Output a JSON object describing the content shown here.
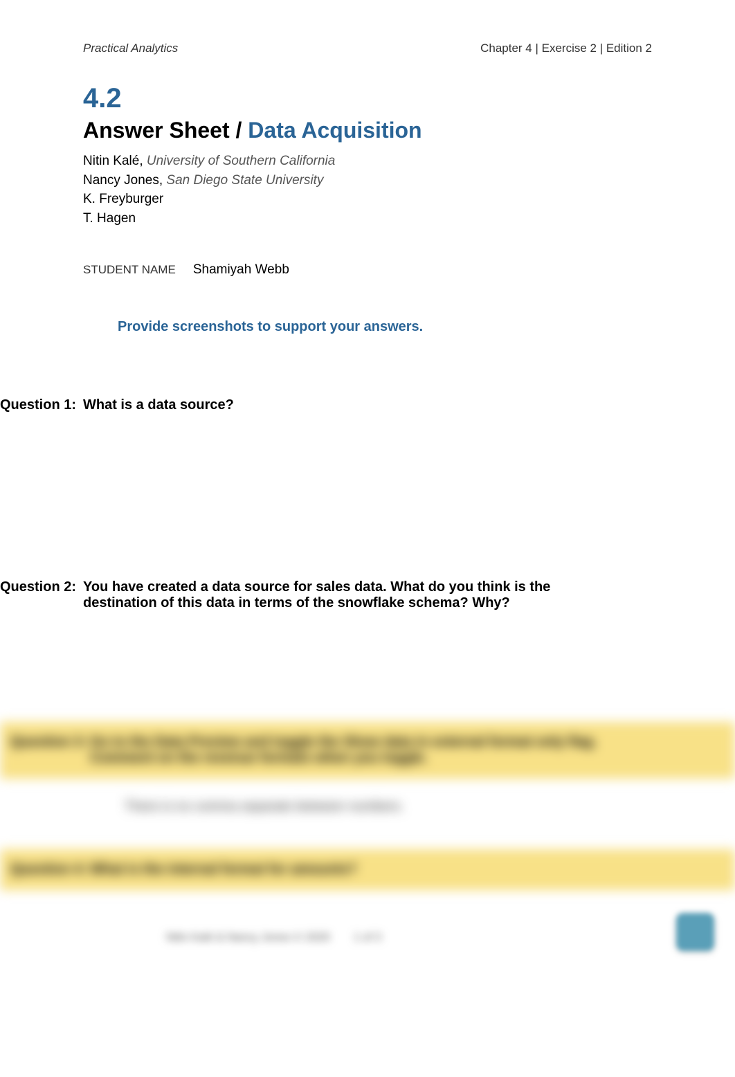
{
  "header": {
    "left": "Practical Analytics",
    "right": "Chapter 4 | Exercise 2 | Edition 2"
  },
  "section_number": "4.2",
  "title": {
    "prefix": "Answer Sheet / ",
    "topic": "Data Acquisition"
  },
  "authors": [
    {
      "name": "Nitin Kalé,",
      "affiliation": "University of Southern California"
    },
    {
      "name": "Nancy Jones,",
      "affiliation": "San Diego State University"
    },
    {
      "name": "K. Freyburger",
      "affiliation": ""
    },
    {
      "name": "T. Hagen",
      "affiliation": ""
    }
  ],
  "student": {
    "label": "STUDENT NAME",
    "value": "Shamiyah Webb"
  },
  "instruction": "Provide screenshots to support your answers.",
  "questions": [
    {
      "label": "Question 1:",
      "text": "What is a data source?"
    },
    {
      "label": "Question 2:",
      "text": "You have created a data source for sales data. What do you think is the destination of this data in terms of the snowflake schema? Why?"
    }
  ],
  "blurred": {
    "q3": {
      "label": "Question 3:",
      "text": "Go to the Data Preview and toggle the Show data in external format only flag. Comment on the revenue formats when you toggle."
    },
    "q3_answer": "There is no comma separate between numbers.",
    "q4": {
      "label": "Question 4:",
      "text": "What is the internal format for amounts?"
    }
  },
  "footer": {
    "left": "Nitin Kalé & Nancy Jones © 2020",
    "center": "1 of 3"
  }
}
